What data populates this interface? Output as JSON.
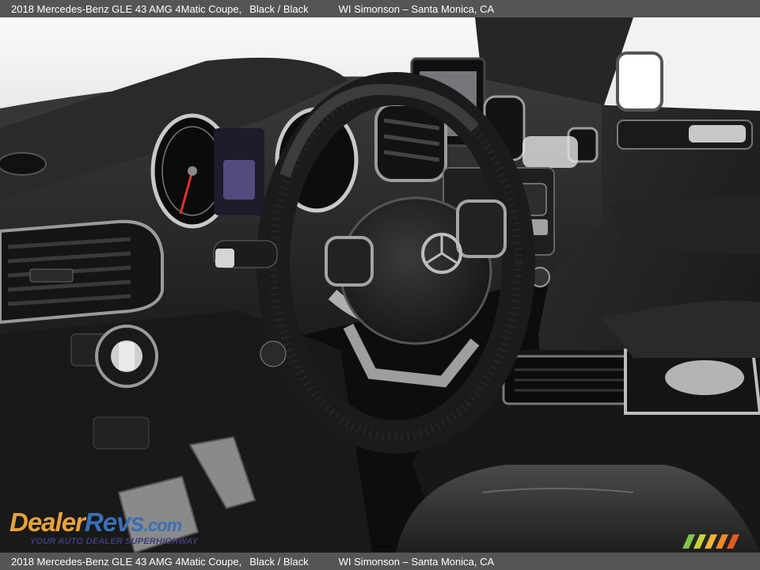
{
  "caption": {
    "title": "2018 Mercedes-Benz GLE 43 AMG 4Matic Coupe,",
    "color": "Black / Black",
    "dealer": "WI Simonson – Santa Monica, CA"
  },
  "watermark": {
    "brand_dealer": "Dealer",
    "brand_revs": "Revs",
    "brand_com": ".com",
    "tagline": "YOUR AUTO DEALER SUPERHIGHWAY"
  },
  "colors": {
    "caption_bg": "#555555",
    "logo_orange": "#e8a23a",
    "logo_blue": "#3b6fb6"
  }
}
